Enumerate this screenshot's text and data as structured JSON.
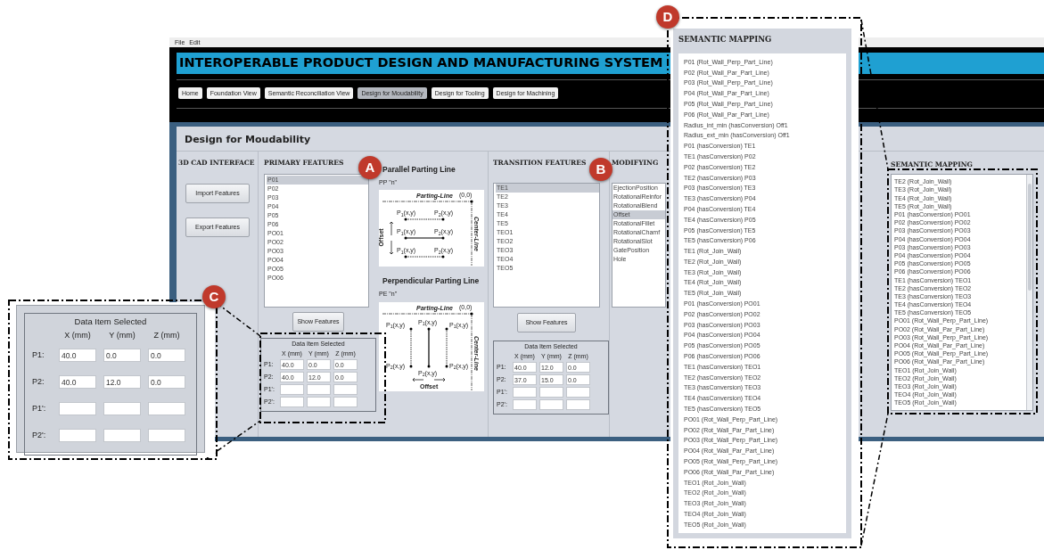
{
  "menu": [
    "File",
    "Edit"
  ],
  "app_title": "INTEROPERABLE PRODUCT DESIGN AND MANUFACTURING SYSTEM",
  "nav_tabs": [
    {
      "label": "Home",
      "selected": false
    },
    {
      "label": "Foundation View",
      "selected": false
    },
    {
      "label": "Semantic Reconciliation View",
      "selected": false
    },
    {
      "label": "Design for Moudability",
      "selected": true
    },
    {
      "label": "Design for Tooling",
      "selected": false
    },
    {
      "label": "Design for Machining",
      "selected": false
    }
  ],
  "page_title": "Design for Moudability",
  "cad_interface": {
    "heading": "3D CAD INTERFACE",
    "buttons": [
      "Import Features",
      "Export Features"
    ]
  },
  "primary_features": {
    "heading": "PRIMARY FEATURES",
    "items": [
      {
        "label": "P01",
        "selected": true
      },
      {
        "label": "P02",
        "selected": false
      },
      {
        "label": "P03",
        "selected": false
      },
      {
        "label": "P04",
        "selected": false
      },
      {
        "label": "P05",
        "selected": false
      },
      {
        "label": "P06",
        "selected": false
      },
      {
        "label": "PO01",
        "selected": false
      },
      {
        "label": "PO02",
        "selected": false
      },
      {
        "label": "PO03",
        "selected": false
      },
      {
        "label": "PO04",
        "selected": false
      },
      {
        "label": "PO05",
        "selected": false
      },
      {
        "label": "PO06",
        "selected": false
      }
    ],
    "button": "Show Features",
    "data_box": {
      "title": "Data Item Selected",
      "columns": [
        "X (mm)",
        "Y (mm)",
        "Z (mm)"
      ],
      "rows": [
        {
          "label": "P1:",
          "values": [
            "40.0",
            "0.0",
            "0.0"
          ]
        },
        {
          "label": "P2:",
          "values": [
            "40.0",
            "12.0",
            "0.0"
          ]
        },
        {
          "label": "P1':"
        },
        {
          "label": "P2':"
        }
      ]
    }
  },
  "parting_lines": [
    {
      "kind": "parallel",
      "title": "Parallel Parting Line",
      "code": "PP \"n\"",
      "parting_line": "Parting-Line",
      "origin": "(0,0)",
      "center_line": "Center-Line",
      "offset": "Offset",
      "points": [
        "P$_{1}$(x,y)",
        "P$_{2}$(x,y)",
        "P$_{1}$(x,y)",
        "P$_{2}$(x,y)",
        "P$_{1}$(x,y)",
        "P$_{2}$(x,y)"
      ]
    },
    {
      "kind": "perpendicular",
      "title": "Perpendicular Parting Line",
      "code": "PE \"n\"",
      "parting_line": "Parting-Line",
      "origin": "(0,0)",
      "center_line": "Center-Line",
      "offset": "Offset",
      "points": [
        "P$_{1}$(x,y)",
        "P$_{1}$(x,y)",
        "P$_{1}$(x,y)",
        "P$_{2}$(x,y)",
        "P$_{2}$(x,y)",
        "P$_{2}$(x,y)"
      ]
    }
  ],
  "transition_features": {
    "heading": "TRANSITION FEATURES",
    "items": [
      {
        "label": "TE1",
        "selected": true
      },
      {
        "label": "TE2",
        "selected": false
      },
      {
        "label": "TE3",
        "selected": false
      },
      {
        "label": "TE4",
        "selected": false
      },
      {
        "label": "TE5",
        "selected": false
      },
      {
        "label": "TEO1",
        "selected": false
      },
      {
        "label": "TEO2",
        "selected": false
      },
      {
        "label": "TEO3",
        "selected": false
      },
      {
        "label": "TEO4",
        "selected": false
      },
      {
        "label": "TEO5",
        "selected": false
      }
    ],
    "button": "Show Features",
    "data_box": {
      "title": "Data Item Selected",
      "columns": [
        "X (mm)",
        "Y (mm)",
        "Z (mm)"
      ],
      "rows": [
        {
          "label": "P1:",
          "values": [
            "40.0",
            "12.0",
            "0.0"
          ]
        },
        {
          "label": "P2:",
          "values": [
            "37.0",
            "15.0",
            "0.0"
          ]
        },
        {
          "label": "P1':"
        },
        {
          "label": "P2':"
        }
      ]
    }
  },
  "modifying_features": {
    "heading": "MODIFYING",
    "items": [
      {
        "label": "EjectionPosition",
        "selected": false
      },
      {
        "label": "RotationalReinfor",
        "selected": false
      },
      {
        "label": "RotationalBlend",
        "selected": false
      },
      {
        "label": "Offset",
        "selected": true
      },
      {
        "label": "RotationalFillet",
        "selected": false
      },
      {
        "label": "RotationalChamf",
        "selected": false
      },
      {
        "label": "RotationalSlot",
        "selected": false
      },
      {
        "label": "GatePosition",
        "selected": false
      },
      {
        "label": "Hole",
        "selected": false
      }
    ]
  },
  "semantic_mapping": {
    "heading": "SEMANTIC MAPPING",
    "items": [
      "TE2 (Rot_Join_Wall)",
      "TE3 (Rot_Join_Wall)",
      "TE4 (Rot_Join_Wall)",
      "TE5 (Rot_Join_Wall)",
      "P01 (hasConversion) PO01",
      "P02 (hasConversion) PO02",
      "P03 (hasConversion) PO03",
      "P04 (hasConversion) PO04",
      "P03 (hasConversion) PO03",
      "P04 (hasConversion) PO04",
      "P05 (hasConversion) PO05",
      "P06 (hasConversion) PO06",
      "TE1 (hasConversion) TEO1",
      "TE2 (hasConversion) TEO2",
      "TE3 (hasConversion) TEO3",
      "TE4 (hasConversion) TEO4",
      "TE5 (hasConversion) TEO5",
      "PO01 (Rot_Wall_Perp_Part_Line)",
      "PO02 (Rot_Wall_Par_Part_Line)",
      "PO03 (Rot_Wall_Perp_Part_Line)",
      "PO04 (Rot_Wall_Par_Part_Line)",
      "PO05 (Rot_Wall_Perp_Part_Line)",
      "PO06 (Rot_Wall_Par_Part_Line)",
      "TEO1 (Rot_Join_Wall)",
      "TEO2 (Rot_Join_Wall)",
      "TEO3 (Rot_Join_Wall)",
      "TEO4 (Rot_Join_Wall)",
      "TEO5 (Rot_Join_Wall)"
    ]
  },
  "callouts": [
    {
      "letter": "A"
    },
    {
      "letter": "B"
    },
    {
      "letter": "C"
    },
    {
      "letter": "D"
    }
  ],
  "callout_c": {
    "title": "Data Item Selected",
    "columns": [
      "X (mm)",
      "Y (mm)",
      "Z (mm)"
    ],
    "rows": [
      {
        "label": "P1:",
        "values": [
          "40.0",
          "0.0",
          "0.0"
        ]
      },
      {
        "label": "P2:",
        "values": [
          "40.0",
          "12.0",
          "0.0"
        ]
      },
      {
        "label": "P1':"
      },
      {
        "label": "P2':"
      }
    ]
  },
  "callout_d": {
    "heading": "SEMANTIC MAPPING",
    "items": [
      "P01 (Rot_Wall_Perp_Part_Line)",
      "P02 (Rot_Wall_Par_Part_Line)",
      "P03 (Rot_Wall_Perp_Part_Line)",
      "P04 (Rot_Wall_Par_Part_Line)",
      "P05 (Rot_Wall_Perp_Part_Line)",
      "P06 (Rot_Wall_Par_Part_Line)",
      "Radius_int_min (hasConversion) Off1",
      "Radius_ext_min (hasConversion) Off1",
      "P01 (hasConversion) TE1",
      "TE1 (hasConversion) P02",
      "P02 (hasConversion) TE2",
      "TE2 (hasConversion) P03",
      "P03 (hasConversion) TE3",
      "TE3 (hasConversion) P04",
      "P04 (hasConversion) TE4",
      "TE4 (hasConversion) P05",
      "P05 (hasConversion) TE5",
      "TE5 (hasConversion) P06",
      "TE1 (Rot_Join_Wall)",
      "TE2 (Rot_Join_Wall)",
      "TE3 (Rot_Join_Wall)",
      "TE4 (Rot_Join_Wall)",
      "TE5 (Rot_Join_Wall)",
      "P01 (hasConversion) PO01",
      "P02 (hasConversion) PO02",
      "P03 (hasConversion) PO03",
      "P04 (hasConversion) PO04",
      "P05 (hasConversion) PO05",
      "P06 (hasConversion) PO06",
      "TE1 (hasConversion) TEO1",
      "TE2 (hasConversion) TEO2",
      "TE3 (hasConversion) TEO3",
      "TE4 (hasConversion) TEO4",
      "TE5 (hasConversion) TEO5",
      "PO01 (Rot_Wall_Perp_Part_Line)",
      "PO02 (Rot_Wall_Par_Part_Line)",
      "PO03 (Rot_Wall_Perp_Part_Line)",
      "PO04 (Rot_Wall_Par_Part_Line)",
      "PO05 (Rot_Wall_Perp_Part_Line)",
      "PO06 (Rot_Wall_Par_Part_Line)",
      "TEO1 (Rot_Join_Wall)",
      "TEO2 (Rot_Join_Wall)",
      "TEO3 (Rot_Join_Wall)",
      "TEO4 (Rot_Join_Wall)",
      "TEO5 (Rot_Join_Wall)"
    ]
  }
}
